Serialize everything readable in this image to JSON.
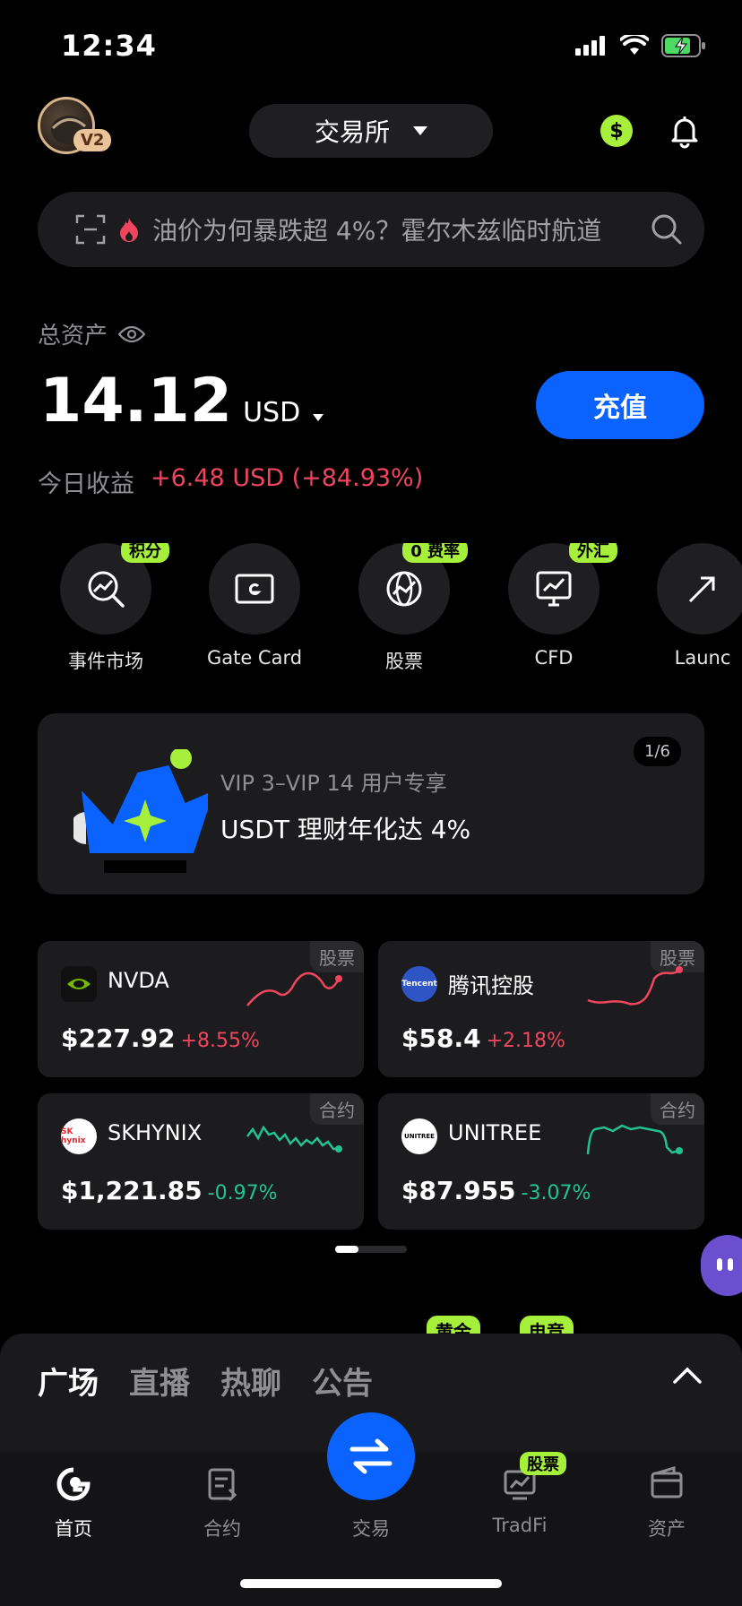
{
  "status_bar": {
    "time": "12:34"
  },
  "header": {
    "vip_level": "V2",
    "exchange_label": "交易所"
  },
  "search": {
    "placeholder": "油价为何暴跌超 4%？霍尔木兹临时航道"
  },
  "assets": {
    "label": "总资产",
    "value": "14.12",
    "currency": "USD",
    "deposit_label": "充值",
    "today_label": "今日收益",
    "today_value": "+6.48 USD (+84.93%)"
  },
  "shortcuts": [
    {
      "label": "事件市场",
      "tag": "积分",
      "icon": "event-market-icon"
    },
    {
      "label": "Gate Card",
      "tag": "",
      "icon": "card-icon"
    },
    {
      "label": "股票",
      "tag": "0 费率",
      "icon": "globe-icon"
    },
    {
      "label": "CFD",
      "tag": "外汇",
      "icon": "chart-monitor-icon"
    },
    {
      "label": "Launc",
      "tag": "",
      "icon": "launch-icon"
    }
  ],
  "promo": {
    "counter": "1/6",
    "subtitle": "VIP 3–VIP 14 用户专享",
    "title": "USDT 理财年化达 4%"
  },
  "markets": [
    {
      "name": "NVDA",
      "type": "股票",
      "price": "$227.92",
      "change": "+8.55%",
      "direction": "up",
      "logo_text": ""
    },
    {
      "name": "腾讯控股",
      "type": "股票",
      "price": "$58.4",
      "change": "+2.18%",
      "direction": "up",
      "logo_text": "Tencent"
    },
    {
      "name": "SKHYNIX",
      "type": "合约",
      "price": "$1,221.85",
      "change": "-0.97%",
      "direction": "down",
      "logo_text": "SK hynix"
    },
    {
      "name": "UNITREE",
      "type": "合约",
      "price": "$87.955",
      "change": "-3.07%",
      "direction": "down",
      "logo_text": "UNITREE"
    }
  ],
  "hidden_tabs": {
    "tag_gold": "黄金",
    "tag_esports": "电竞"
  },
  "feed_tabs": [
    "广场",
    "直播",
    "热聊",
    "公告"
  ],
  "tabbar": {
    "home": "首页",
    "futures": "合约",
    "trade": "交易",
    "tradfi": "TradFi",
    "tradfi_badge": "股票",
    "assets": "资产"
  },
  "colors": {
    "accent_blue": "#0a63ff",
    "accent_green": "#a6ef3a",
    "up_red": "#f0455f",
    "down_green": "#22c38e"
  }
}
